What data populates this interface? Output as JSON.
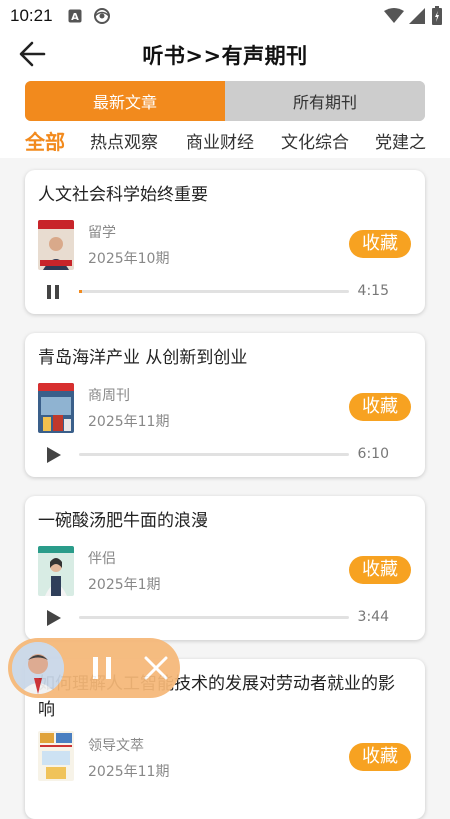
{
  "status_bar": {
    "time": "10:21",
    "icons": [
      "notification-a-icon",
      "accessibility-icon",
      "wifi-icon",
      "signal-icon",
      "battery-icon"
    ]
  },
  "header": {
    "back_icon": "arrow-left-icon",
    "title": "听书>>有声期刊"
  },
  "segments": {
    "latest": "最新文章",
    "all": "所有期刊",
    "active": "latest"
  },
  "categories": [
    "全部",
    "热点观察",
    "商业财经",
    "文化综合",
    "党建之"
  ],
  "articles": [
    {
      "title": "人文社会科学始终重要",
      "magazine": "留学",
      "issue": "2025年10期",
      "favorite": "收藏",
      "duration": "4:15",
      "state": "playing",
      "progress": 0.01
    },
    {
      "title": "青岛海洋产业 从创新到创业",
      "magazine": "商周刊",
      "issue": "2025年11期",
      "favorite": "收藏",
      "duration": "6:10",
      "state": "paused",
      "progress": 0
    },
    {
      "title": "一碗酸汤肥牛面的浪漫",
      "magazine": "伴侣",
      "issue": "2025年1期",
      "favorite": "收藏",
      "duration": "3:44",
      "state": "paused",
      "progress": 0
    },
    {
      "title_line1": "如何理解人工智能技术的发展对劳动者就业的影",
      "title_line2": "响",
      "magazine": "领导文萃",
      "issue": "2025年11期",
      "favorite": "收藏"
    }
  ],
  "mini_player": {
    "pause_icon": "pause-icon",
    "close_icon": "close-icon"
  },
  "colors": {
    "accent": "#f28a1d",
    "favorite_bg": "#f7a221",
    "mini_player_bg": "#f6b878"
  }
}
